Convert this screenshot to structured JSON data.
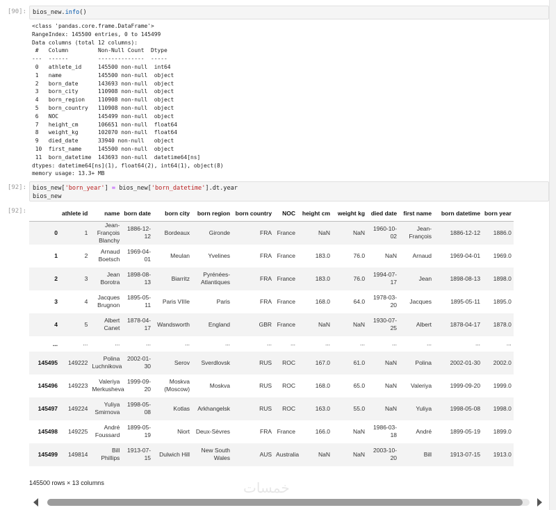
{
  "cells": {
    "info": {
      "prompt": "[90]:",
      "code_obj": "bios_new",
      "code_method": "info",
      "code_rest": "()",
      "output_lines": [
        "<class 'pandas.core.frame.DataFrame'>",
        "RangeIndex: 145500 entries, 0 to 145499",
        "Data columns (total 12 columns):",
        " #   Column         Non-Null Count  Dtype",
        "---  ------         --------------  -----",
        " 0   athlete_id     145500 non-null  int64",
        " 1   name           145500 non-null  object",
        " 2   born_date      143693 non-null  object",
        " 3   born_city      110908 non-null  object",
        " 4   born_region    110908 non-null  object",
        " 5   born_country   110908 non-null  object",
        " 6   NOC            145499 non-null  object",
        " 7   height_cm      106651 non-null  float64",
        " 8   weight_kg      102070 non-null  float64",
        " 9   died_date      33940 non-null   object",
        " 10  first_name     145500 non-null  object",
        " 11  born_datetime  143693 non-null  datetime64[ns]",
        "dtypes: datetime64[ns](1), float64(2), int64(1), object(8)",
        "memory usage: 13.3+ MB"
      ]
    },
    "assign": {
      "prompt": "[92]:",
      "line1_a": "bios_new[",
      "line1_str1": "'born_year'",
      "line1_b": "] ",
      "line1_eq": "=",
      "line1_c": " bios_new[",
      "line1_str2": "'born_datetime'",
      "line1_d": "].dt.year",
      "line2": "bios_new"
    },
    "result": {
      "prompt": "[92]:"
    }
  },
  "dataframe": {
    "columns": [
      "",
      "athlete id",
      "name",
      "born date",
      "born city",
      "born region",
      "born country",
      "NOC",
      "height cm",
      "weight kg",
      "died date",
      "first name",
      "born datetime",
      "born year"
    ],
    "rows": [
      [
        "0",
        "1",
        "Jean-François Blanchy",
        "1886-12-12",
        "Bordeaux",
        "Gironde",
        "FRA",
        "France",
        "NaN",
        "NaN",
        "1960-10-02",
        "Jean-François",
        "1886-12-12",
        "1886.0"
      ],
      [
        "1",
        "2",
        "Arnaud Boetsch",
        "1969-04-01",
        "Meulan",
        "Yvelines",
        "FRA",
        "France",
        "183.0",
        "76.0",
        "NaN",
        "Arnaud",
        "1969-04-01",
        "1969.0"
      ],
      [
        "2",
        "3",
        "Jean Borotra",
        "1898-08-13",
        "Biarritz",
        "Pyrénées-Atlantiques",
        "FRA",
        "France",
        "183.0",
        "76.0",
        "1994-07-17",
        "Jean",
        "1898-08-13",
        "1898.0"
      ],
      [
        "3",
        "4",
        "Jacques Brugnon",
        "1895-05-11",
        "Paris VIIIe",
        "Paris",
        "FRA",
        "France",
        "168.0",
        "64.0",
        "1978-03-20",
        "Jacques",
        "1895-05-11",
        "1895.0"
      ],
      [
        "4",
        "5",
        "Albert Canet",
        "1878-04-17",
        "Wandsworth",
        "England",
        "GBR",
        "France",
        "NaN",
        "NaN",
        "1930-07-25",
        "Albert",
        "1878-04-17",
        "1878.0"
      ],
      [
        "...",
        "...",
        "...",
        "...",
        "...",
        "...",
        "...",
        "...",
        "...",
        "...",
        "...",
        "...",
        "...",
        "..."
      ],
      [
        "145495",
        "149222",
        "Polina Luchnikova",
        "2002-01-30",
        "Serov",
        "Sverdlovsk",
        "RUS",
        "ROC",
        "167.0",
        "61.0",
        "NaN",
        "Polina",
        "2002-01-30",
        "2002.0"
      ],
      [
        "145496",
        "149223",
        "Valeriya Merkusheva",
        "1999-09-20",
        "Moskva (Moscow)",
        "Moskva",
        "RUS",
        "ROC",
        "168.0",
        "65.0",
        "NaN",
        "Valeriya",
        "1999-09-20",
        "1999.0"
      ],
      [
        "145497",
        "149224",
        "Yuliya Smirnova",
        "1998-05-08",
        "Kotlas",
        "Arkhangelsk",
        "RUS",
        "ROC",
        "163.0",
        "55.0",
        "NaN",
        "Yuliya",
        "1998-05-08",
        "1998.0"
      ],
      [
        "145498",
        "149225",
        "André Foussard",
        "1899-05-19",
        "Niort",
        "Deux-Sèvres",
        "FRA",
        "France",
        "166.0",
        "NaN",
        "1986-03-18",
        "André",
        "1899-05-19",
        "1899.0"
      ],
      [
        "145499",
        "149814",
        "Bill Phillips",
        "1913-07-15",
        "Dulwich Hill",
        "New South Wales",
        "AUS",
        "Australia",
        "NaN",
        "NaN",
        "2003-10-20",
        "Bill",
        "1913-07-15",
        "1913.0"
      ]
    ],
    "footer": "145500 rows × 13 columns"
  },
  "watermark": "خمسات"
}
